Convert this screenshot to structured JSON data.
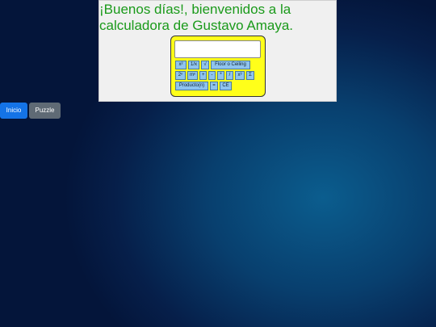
{
  "header": {
    "greeting": "¡Buenos días!, bienvenidos a la calculadora de Gustavo Amaya."
  },
  "calculator": {
    "display_value": "",
    "rows": [
      [
        "x²",
        "1/x",
        "√",
        "Floor o Ceiling"
      ],
      [
        "2ⁿ",
        "mⁿ",
        "+",
        "-",
        "*",
        "/",
        "x³",
        "Σ"
      ],
      [
        "Producto(n)",
        "=",
        "CE"
      ]
    ]
  },
  "nav": {
    "inicio": "Inicio",
    "puzzle": "Puzzle"
  },
  "colors": {
    "greeting_text": "#1a9a1a",
    "calculator_body": "#ffff1a",
    "key_fill": "#8fc4ee",
    "inicio_button": "#1473e6",
    "puzzle_button": "#5f6a75"
  }
}
